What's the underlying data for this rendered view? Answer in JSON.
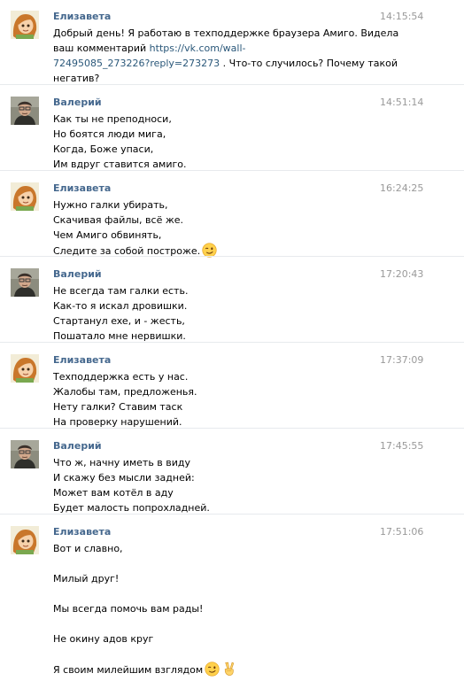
{
  "messages": [
    {
      "author": "Елизавета",
      "avatar": "elizaveta-avatar",
      "time": "14:15:54",
      "lines": [
        {
          "text": "Добрый день! Я работаю в техподдержке браузера Амиго. Видела"
        },
        {
          "text": "ваш комментарий ",
          "link": "https://vk.com/wall-"
        },
        {
          "link": "72495085_273226?reply=273273",
          "text": " . Что-то случилось? Почему такой"
        },
        {
          "text": "негатив?"
        }
      ]
    },
    {
      "author": "Валерий",
      "avatar": "valeriy-avatar",
      "time": "14:51:14",
      "lines": [
        {
          "text": "Как ты не преподноси,"
        },
        {
          "text": "Но боятся люди мига,"
        },
        {
          "text": "Когда, Боже упаси,"
        },
        {
          "text": "Им вдруг ставится амиго."
        }
      ]
    },
    {
      "author": "Елизавета",
      "avatar": "elizaveta-avatar",
      "time": "16:24:25",
      "lines": [
        {
          "text": "Нужно галки убирать,"
        },
        {
          "text": "Скачивая файлы, всё же."
        },
        {
          "text": "Чем Амиго обвинять,"
        },
        {
          "text": "Следите за собой построже.",
          "emoji": [
            "wink-emoji"
          ]
        }
      ]
    },
    {
      "author": "Валерий",
      "avatar": "valeriy-avatar",
      "time": "17:20:43",
      "lines": [
        {
          "text": "Не всегда там галки есть."
        },
        {
          "text": "Как-то я искал дровишки."
        },
        {
          "text": "Стартанул exe, и - жесть,"
        },
        {
          "text": "Пошатало мне нервишки."
        }
      ]
    },
    {
      "author": "Елизавета",
      "avatar": "elizaveta-avatar",
      "time": "17:37:09",
      "lines": [
        {
          "text": "Техподдержка есть у нас."
        },
        {
          "text": "Жалобы там, предложенья."
        },
        {
          "text": "Нету галки? Ставим таск"
        },
        {
          "text": "На проверку нарушений."
        }
      ]
    },
    {
      "author": "Валерий",
      "avatar": "valeriy-avatar",
      "time": "17:45:55",
      "lines": [
        {
          "text": "Что ж, начну иметь в виду"
        },
        {
          "text": "И скажу без мысли задней:"
        },
        {
          "text": "Может вам котёл в аду"
        },
        {
          "text": "Будет малость попрохладней."
        }
      ]
    },
    {
      "author": "Елизавета",
      "avatar": "elizaveta-avatar",
      "time": "17:51:06",
      "lines": [
        {
          "text": "Вот и славно,"
        },
        {
          "gap": true
        },
        {
          "text": "Милый друг!"
        },
        {
          "gap": true
        },
        {
          "text": "Мы всегда помочь вам рады!"
        },
        {
          "gap": true
        },
        {
          "text": "Не окину адов круг"
        },
        {
          "gap": true
        },
        {
          "text": "Я своим милейшим взглядом",
          "emoji": [
            "wink-emoji",
            "victory-hand-emoji"
          ]
        }
      ]
    }
  ]
}
